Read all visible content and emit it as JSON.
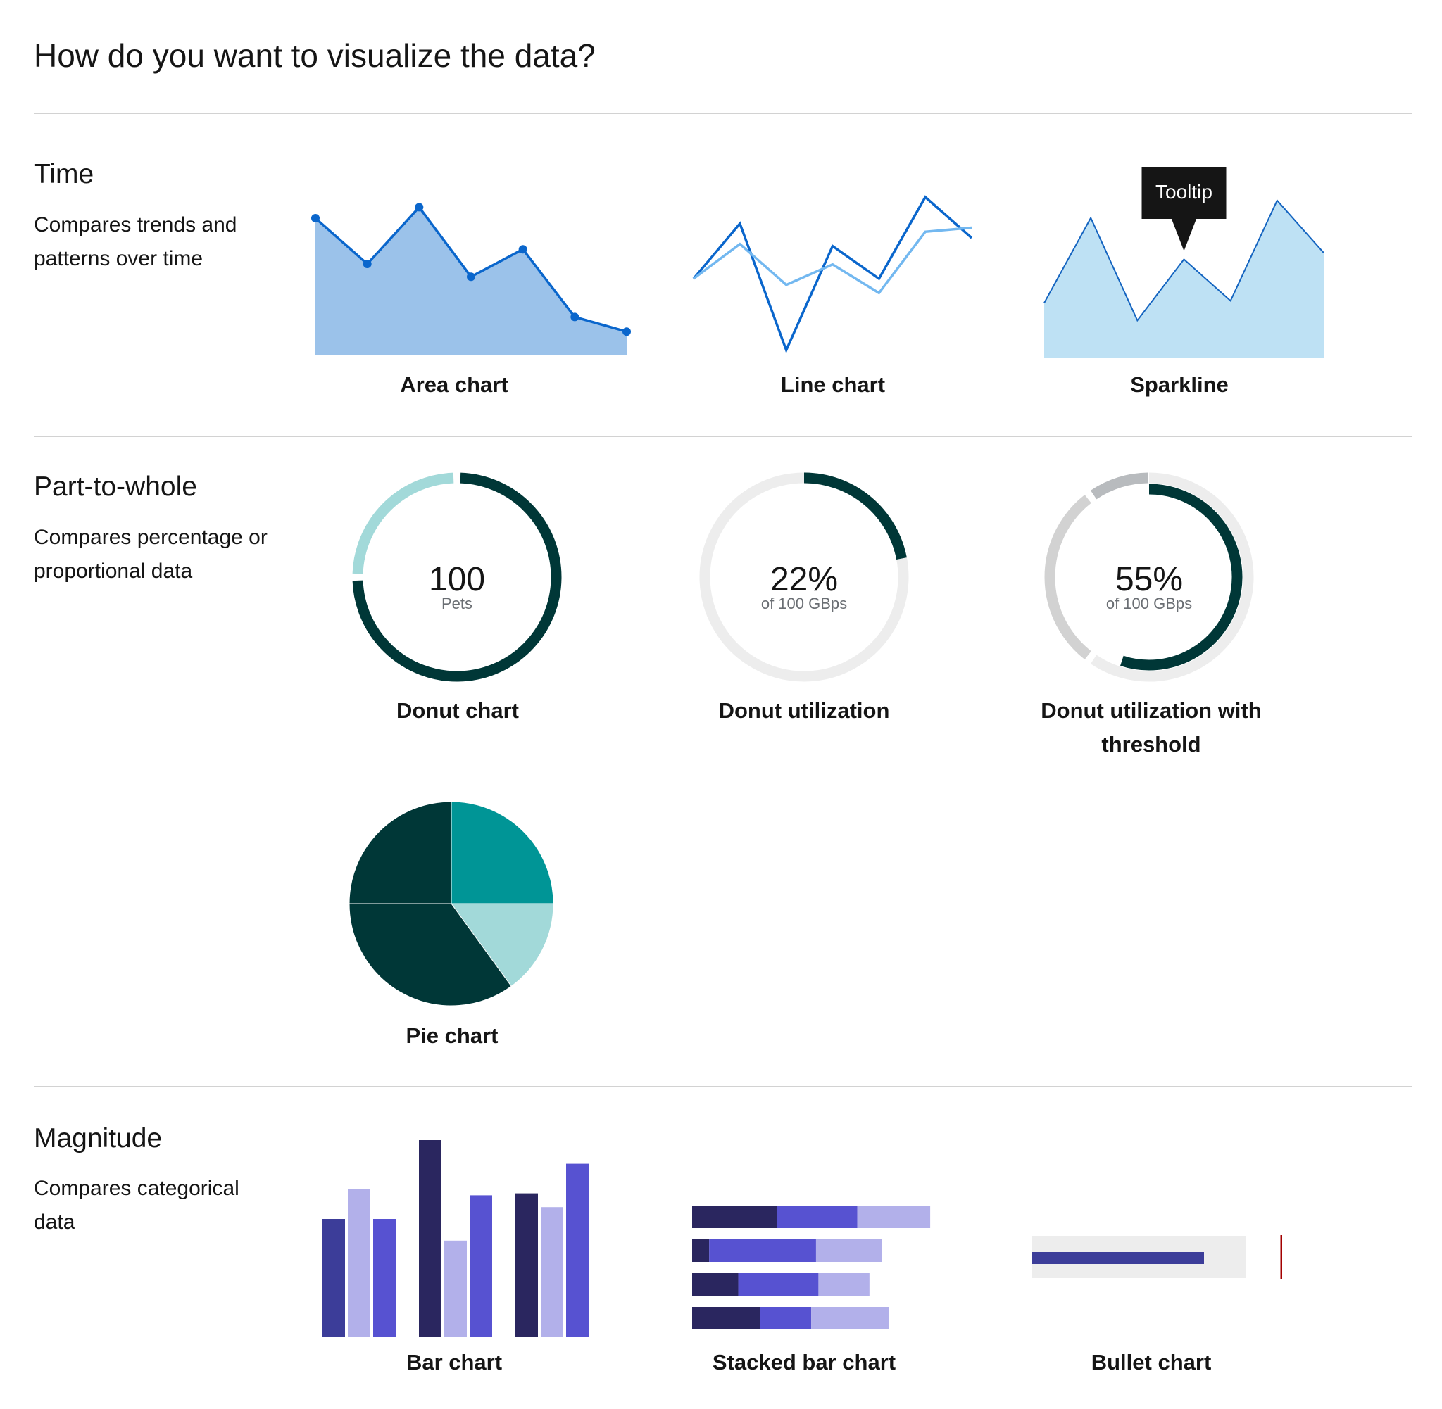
{
  "page": {
    "title": "How do you want to visualize the data?"
  },
  "colors": {
    "area_fill": "#9bc2ea",
    "area_line": "#0a66cc",
    "line_dark": "#0a66cc",
    "line_light": "#73b8f0",
    "spark_fill": "#bee1f4",
    "spark_line": "#1464c0",
    "tooltip_bg": "#151515",
    "donut_dark": "#003737",
    "donut_light": "#a2d9d9",
    "donut_track": "#ededed",
    "threshold_light": "#d2d2d2",
    "threshold_mid": "#b8bbbe",
    "pie_dark": "#003737",
    "pie_teal": "#009596",
    "pie_light": "#a2d9d9",
    "bar_navy": "#2a265f",
    "bar_indigo": "#3c3d99",
    "bar_lavender": "#b2b0ea",
    "bar_purple": "#5752d1",
    "bullet_track": "#ededed",
    "bullet_marker": "#a30000"
  },
  "sections": [
    {
      "title": "Time",
      "description": "Compares trends and patterns over time",
      "charts": [
        {
          "caption": "Area chart",
          "chart_data": {
            "type": "area",
            "values": [
              75,
              50,
              81,
              43,
              58,
              21,
              13
            ],
            "markers": true
          }
        },
        {
          "caption": "Line chart",
          "chart_data": {
            "type": "line",
            "series": [
              {
                "values": [
                  40,
                  67,
                  5,
                  56,
                  40,
                  80,
                  60
                ]
              },
              {
                "values": [
                  40,
                  57,
                  37,
                  47,
                  33,
                  63,
                  65
                ]
              }
            ]
          }
        },
        {
          "caption": "Sparkline",
          "tooltip": "Tooltip",
          "chart_data": {
            "type": "area",
            "values": [
              25,
              64,
              17,
              45,
              26,
              72,
              48
            ]
          }
        }
      ]
    },
    {
      "title": "Part-to-whole",
      "description": "Compares percentage or proportional data",
      "charts": [
        {
          "caption": "Donut chart",
          "value": "100",
          "subtitle": "Pets",
          "chart_data": {
            "type": "pie",
            "variant": "donut",
            "values": [
              75,
              25
            ]
          }
        },
        {
          "caption": "Donut utilization",
          "value": "22%",
          "subtitle": "of 100 GBps",
          "chart_data": {
            "type": "pie",
            "variant": "donut-utilization",
            "value": 22,
            "max": 100
          }
        },
        {
          "caption": "Donut utilization with threshold",
          "value": "55%",
          "subtitle": "of 100 GBps",
          "chart_data": {
            "type": "pie",
            "variant": "donut-utilization-threshold",
            "value": 55,
            "max": 100,
            "thresholds": [
              60,
              90
            ]
          }
        },
        {
          "caption": "Pie chart",
          "chart_data": {
            "type": "pie",
            "values": [
              25,
              15,
              35,
              25
            ]
          }
        }
      ]
    },
    {
      "title": "Magnitude",
      "description": "Compares categorical data",
      "charts": [
        {
          "caption": "Bar chart",
          "chart_data": {
            "type": "bar",
            "groups": [
              [
                60,
                75,
                60
              ],
              [
                100,
                49,
                72
              ],
              [
                73,
                66,
                88
              ]
            ]
          }
        },
        {
          "caption": "Stacked bar chart",
          "chart_data": {
            "type": "bar",
            "orientation": "horizontal",
            "stacked": true,
            "rows": [
              [
                35,
                33,
                30
              ],
              [
                7,
                44,
                27
              ],
              [
                19,
                33,
                21
              ],
              [
                28,
                21,
                32
              ]
            ]
          }
        },
        {
          "caption": "Bullet chart",
          "chart_data": {
            "type": "bar",
            "variant": "bullet",
            "value": 70,
            "range": 87,
            "target": 101
          }
        }
      ]
    }
  ]
}
